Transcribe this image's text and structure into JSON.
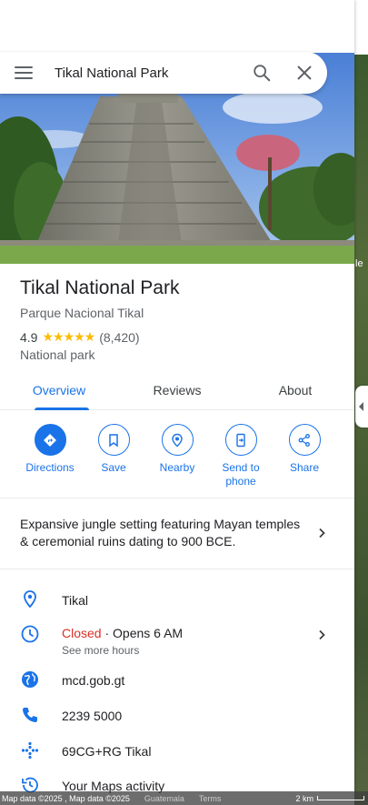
{
  "search": {
    "query": "Tikal National Park"
  },
  "place": {
    "title": "Tikal National Park",
    "subtitle": "Parque Nacional Tikal",
    "rating": "4.9",
    "stars": "★★★★★",
    "review_count": "(8,420)",
    "category": "National park"
  },
  "tabs": [
    {
      "label": "Overview",
      "active": true
    },
    {
      "label": "Reviews",
      "active": false
    },
    {
      "label": "About",
      "active": false
    }
  ],
  "actions": [
    {
      "label": "Directions",
      "icon": "directions-icon"
    },
    {
      "label": "Save",
      "icon": "bookmark-icon"
    },
    {
      "label": "Nearby",
      "icon": "nearby-icon"
    },
    {
      "label": "Send to phone",
      "icon": "send-to-phone-icon"
    },
    {
      "label": "Share",
      "icon": "share-icon"
    }
  ],
  "description": "Expansive jungle setting featuring Mayan temples & ceremonial ruins dating to 900 BCE.",
  "info": {
    "address": "Tikal",
    "hours_status": "Closed",
    "hours_separator": " · ",
    "hours_next": "Opens 6 AM",
    "hours_more": "See more hours",
    "website": "mcd.gob.gt",
    "phone": "2239 5000",
    "plus_code": "69CG+RG Tikal",
    "maps_activity": "Your Maps activity"
  },
  "map_footer": {
    "data": "Map data ©2025 , Map data ©2025",
    "country": "Guatemala",
    "terms": "Terms",
    "scale": "2 km"
  },
  "map_edge": {
    "fragment": "le"
  },
  "colors": {
    "accent": "#1a73e8",
    "closed": "#d93025",
    "star": "#fbbc04"
  }
}
